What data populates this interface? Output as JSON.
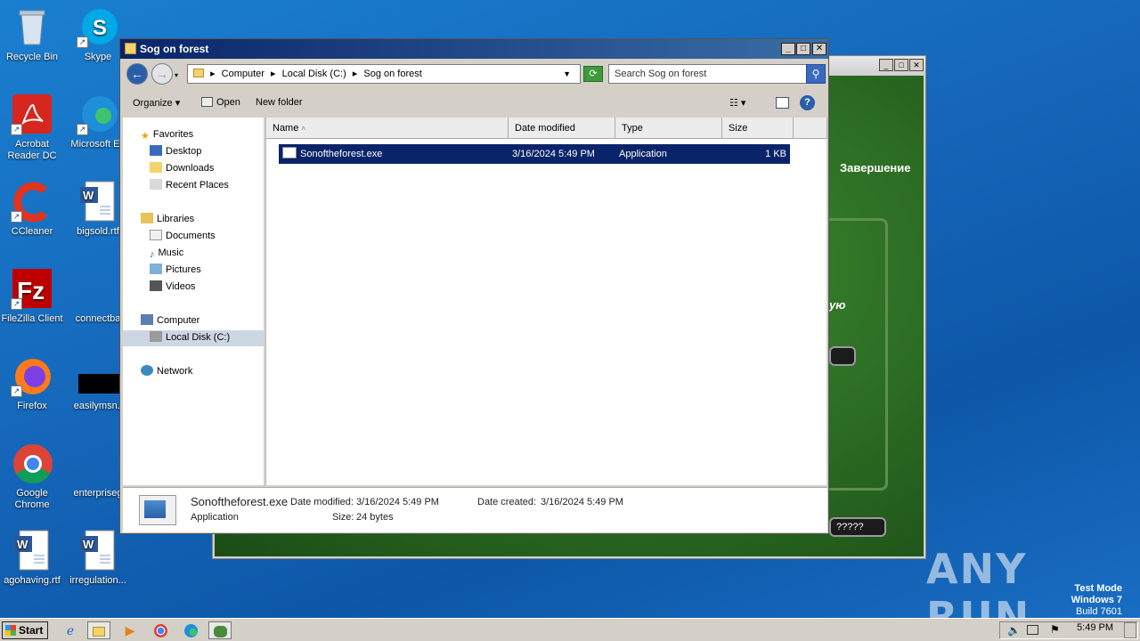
{
  "desktop": {
    "icons": [
      {
        "label": "Recycle Bin"
      },
      {
        "label": "Skype"
      },
      {
        "label": "Acrobat Reader DC"
      },
      {
        "label": "Microsoft Ed"
      },
      {
        "label": "CCleaner"
      },
      {
        "label": "bigsold.rtf"
      },
      {
        "label": "FileZilla Client"
      },
      {
        "label": "connectba"
      },
      {
        "label": "Firefox"
      },
      {
        "label": "easilymsn.j"
      },
      {
        "label": "Google Chrome"
      },
      {
        "label": "enterpriseg"
      },
      {
        "label": "agohaving.rtf"
      },
      {
        "label": "irregulation..."
      }
    ],
    "watermark": {
      "line1": "Test Mode",
      "line2": "Windows 7",
      "line3": "Build 7601"
    },
    "anyrun_logo": "ANY RUN"
  },
  "background_app": {
    "button_label": "Завершение",
    "partial_text": "ую",
    "pill_text": "?????"
  },
  "explorer": {
    "title": "Sog on forest",
    "address": {
      "part1": "Computer",
      "part2": "Local Disk (C:)",
      "part3": "Sog on forest"
    },
    "search_placeholder": "Search Sog on forest",
    "toolbar": {
      "organize": "Organize",
      "open": "Open",
      "new_folder": "New folder"
    },
    "sidebar": {
      "favorites": "Favorites",
      "desktop": "Desktop",
      "downloads": "Downloads",
      "recent_places": "Recent Places",
      "libraries": "Libraries",
      "documents": "Documents",
      "music": "Music",
      "pictures": "Pictures",
      "videos": "Videos",
      "computer": "Computer",
      "local_disk": "Local Disk (C:)",
      "network": "Network"
    },
    "columns": {
      "name": "Name",
      "date_modified": "Date modified",
      "type": "Type",
      "size": "Size"
    },
    "files": [
      {
        "name": "Sonoftheforest.exe",
        "date": "3/16/2024 5:49 PM",
        "type": "Application",
        "size": "1 KB"
      }
    ],
    "details": {
      "filename": "Sonoftheforest.exe",
      "type": "Application",
      "modified_label": "Date modified:",
      "modified_value": "3/16/2024 5:49 PM",
      "created_label": "Date created:",
      "created_value": "3/16/2024 5:49 PM",
      "size_label": "Size:",
      "size_value": "24 bytes"
    }
  },
  "taskbar": {
    "start": "Start",
    "clock": "5:49 PM"
  },
  "colors": {
    "title_active": "#0a246a",
    "selection": "#0a246a",
    "desktop_blue": "#1565b8",
    "app_green": "#2a6a22"
  }
}
